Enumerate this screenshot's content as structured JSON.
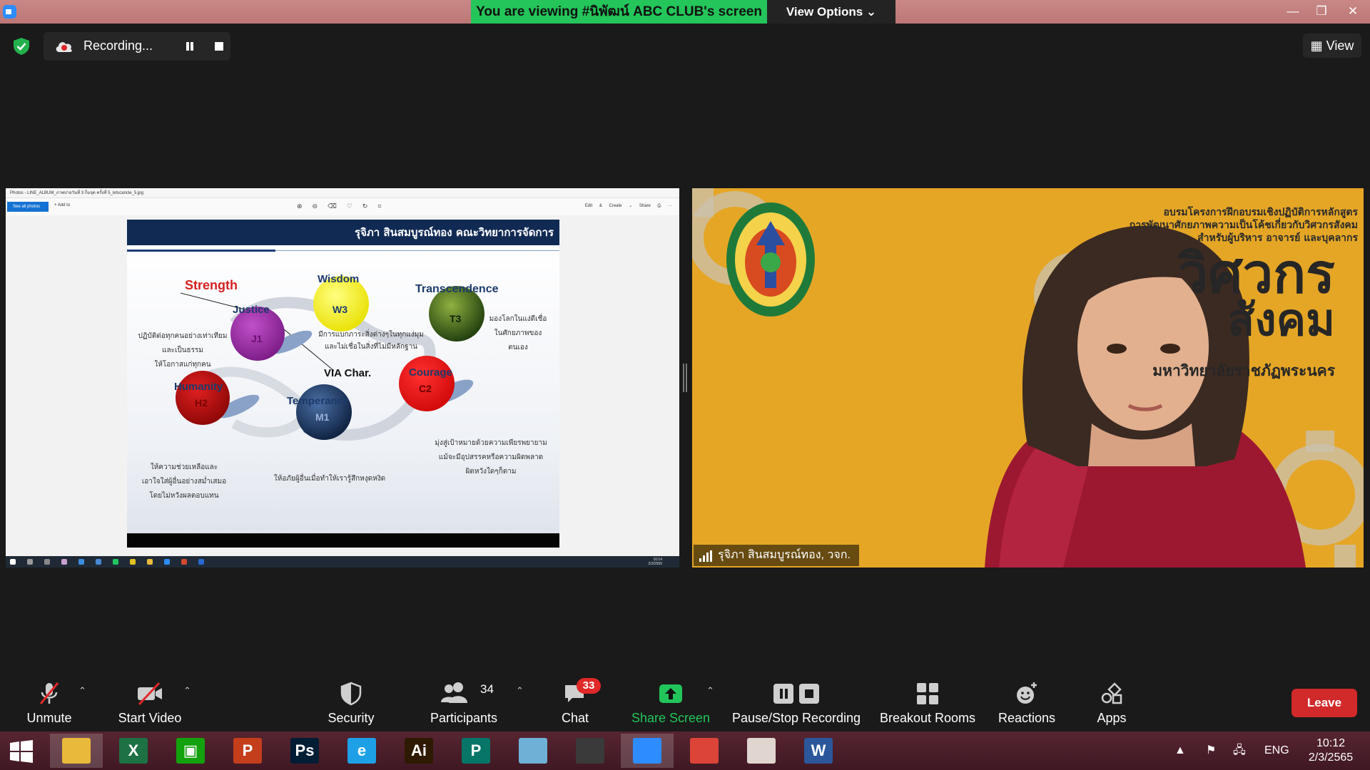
{
  "titlebar": {
    "banner_text": "You are viewing #นิพัฒน์ ABC CLUB's screen",
    "view_options_label": "View Options ⌄",
    "minimize": "—",
    "restore": "❐",
    "close": "✕"
  },
  "recording": {
    "label": "Recording..."
  },
  "view_button": {
    "label": "View"
  },
  "shared_screen": {
    "window_title": "Photos - LINE_ALBUM_ภาพบ่ายวันที่ 3 ก็มจุด ครั้งที่ 5_letscancle_5.jpg",
    "see_all_photos": "See all photos",
    "add_to": "+ Add to",
    "toolbar_right": "Edit & Create ⌄   Share   ⎙   ···",
    "slide_title": "รุจิภา สินสมบูรณ์ทอง คณะวิทยาการจัดการ",
    "taskbar_time": "10:14",
    "taskbar_date": "2/3/2565",
    "diagram": {
      "strength": "Strength",
      "wisdom": "Wisdom",
      "transcendence": "Transcendence",
      "justice": "Justice",
      "humanity": "Humanity",
      "temperance": "Temperance",
      "courage": "Courage",
      "via": "VIA Char.",
      "w3": "W3",
      "t3": "T3",
      "j1": "J1",
      "h2": "H2",
      "m1": "M1",
      "c2": "C2",
      "justice_desc": [
        "ปฏิบัติต่อทุกคนอย่างเท่าเทียม",
        "และเป็นธรรม",
        "ให้โอกาสแก่ทุกคน"
      ],
      "wisdom_desc": [
        "มีการแบกภาระสิ่งต่างๆในทุกแง่มุม",
        "และไม่เชื่อในสิ่งที่ไม่มีหลักฐาน"
      ],
      "transcendence_desc": [
        "มองโลกในแง่ดีเชื่อ",
        "ในศักยภาพของ",
        "ตนเอง"
      ],
      "humanity_desc": [
        "ให้ความช่วยเหลือและ",
        "เอาใจใส่ผู้อื่นอย่างสม่ำเสมอ",
        "โดยไม่หวังผลตอบแทน"
      ],
      "temperance_desc": [
        "ให้อภัยผู้อื่นเมื่อทำให้เรารู้สึกหงุดหงิด"
      ],
      "courage_desc": [
        "มุ่งสู่เป้าหมายด้วยความเพียรพยายาม",
        "แม้จะมีอุปสรรคหรือความผิดพลาด",
        "ผิดหวังใดๆก็ตาม"
      ]
    }
  },
  "video": {
    "banner_line1": "อบรมโครงการฝึกอบรมเชิงปฏิบัติการหลักสูตร",
    "banner_line2": "การพัฒนาศักยภาพความเป็นโค้ชเกี่ยวกับวิศวกรสังคม",
    "banner_line3": "สำหรับผู้บริหาร อาจารย์ และบุคลากร",
    "big_line1": "วิศวกร",
    "big_line2": "สังคม",
    "university": "มหาวิทยาลัยราชภัฏพระนคร",
    "participant_name": "รุจิภา สินสมบูรณ์ทอง, วจก."
  },
  "toolbar": {
    "unmute": "Unmute",
    "start_video": "Start Video",
    "security": "Security",
    "participants": "Participants",
    "participants_count": "34",
    "chat": "Chat",
    "chat_badge": "33",
    "share_screen": "Share Screen",
    "pause_stop_recording": "Pause/Stop Recording",
    "breakout_rooms": "Breakout Rooms",
    "reactions": "Reactions",
    "apps": "Apps",
    "leave": "Leave"
  },
  "taskbar": {
    "apps": [
      {
        "name": "file-explorer",
        "glyph": "",
        "color": "#e8b93a"
      },
      {
        "name": "excel",
        "glyph": "X",
        "color": "#1e7145"
      },
      {
        "name": "store",
        "glyph": "▣",
        "color": "#13a10e"
      },
      {
        "name": "powerpoint",
        "glyph": "P",
        "color": "#c43e1c"
      },
      {
        "name": "photoshop",
        "glyph": "Ps",
        "color": "#001d34"
      },
      {
        "name": "internet-explorer",
        "glyph": "e",
        "color": "#1ea0e6"
      },
      {
        "name": "illustrator",
        "glyph": "Ai",
        "color": "#2e1a00"
      },
      {
        "name": "publisher",
        "glyph": "P",
        "color": "#077568"
      },
      {
        "name": "notes",
        "glyph": "",
        "color": "#6fb1d6"
      },
      {
        "name": "photoscape",
        "glyph": "",
        "color": "#3a3a3a"
      },
      {
        "name": "zoom",
        "glyph": "",
        "color": "#2d8cff"
      },
      {
        "name": "chrome",
        "glyph": "",
        "color": "#db4437"
      },
      {
        "name": "paint",
        "glyph": "",
        "color": "#e0d6cf"
      },
      {
        "name": "word",
        "glyph": "W",
        "color": "#2b579a"
      }
    ],
    "language": "ENG",
    "time": "10:12",
    "date": "2/3/2565"
  }
}
